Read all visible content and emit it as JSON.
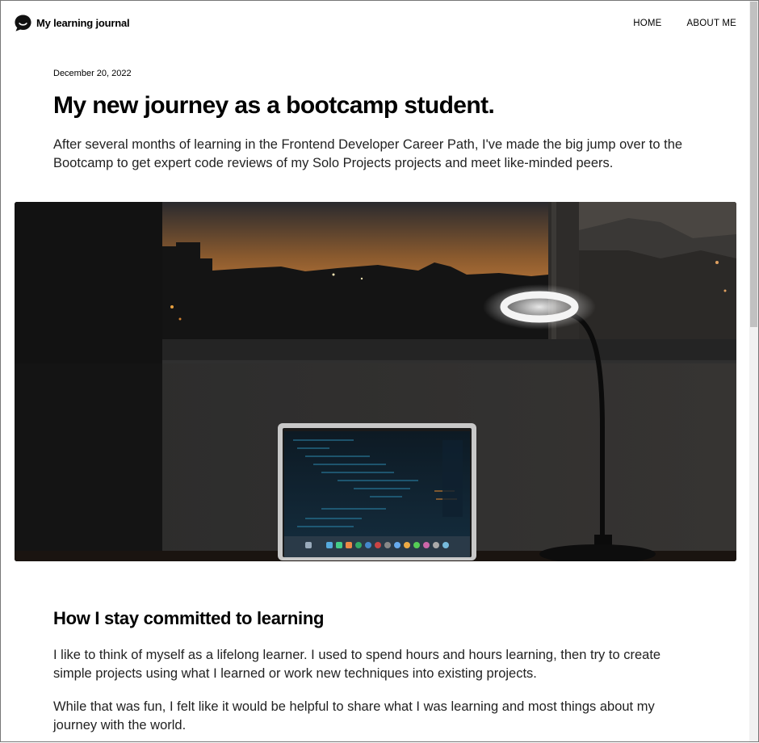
{
  "header": {
    "site_title": "My learning journal",
    "logo_icon": "speech-bubble-logo-icon",
    "nav": [
      {
        "label": "HOME"
      },
      {
        "label": "ABOUT ME"
      }
    ]
  },
  "post": {
    "date": "December 20, 2022",
    "title": "My new journey as a bootcamp student.",
    "intro": "After several months of learning in the Frontend Developer Career Path, I've made the big jump over to the Bootcamp to get expert code reviews of my Solo Projects projects and meet like-minded peers."
  },
  "hero_image": {
    "description_icon": "laptop-desk-lamp-sunset-photo"
  },
  "content": {
    "section_title": "How I stay committed to learning",
    "paragraphs": [
      "I like to think of myself as a lifelong learner. I used to spend hours and hours learning, then try to create simple projects using what I learned or work new techniques into existing projects.",
      "While that was fun, I felt like it would be helpful to share what I was learning and most things about my journey with the world."
    ]
  },
  "colors": {
    "text": "#000000",
    "background": "#ffffff",
    "scrollbar_track": "#f1f1f1",
    "scrollbar_thumb": "#c1c1c1"
  }
}
